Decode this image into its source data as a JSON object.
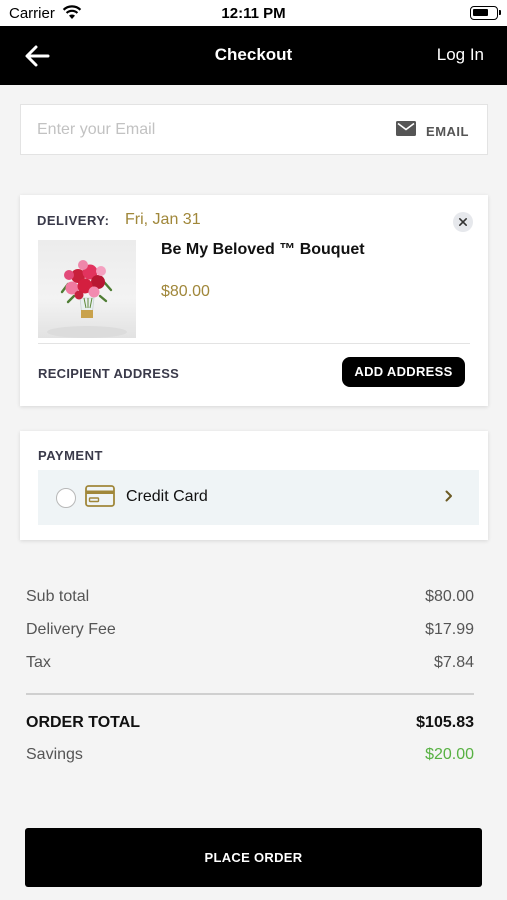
{
  "status_bar": {
    "carrier": "Carrier",
    "time": "12:11 PM"
  },
  "nav": {
    "title": "Checkout",
    "login_label": "Log In"
  },
  "email": {
    "placeholder": "Enter your Email",
    "button_label": "EMAIL"
  },
  "delivery": {
    "label": "DELIVERY:",
    "date": "Fri, Jan 31",
    "product_name": "Be My Beloved ™ Bouquet",
    "product_price": "$80.00",
    "recipient_label": "RECIPIENT ADDRESS",
    "add_address_label": "ADD ADDRESS"
  },
  "payment": {
    "label": "PAYMENT",
    "method_label": "Credit Card"
  },
  "summary": {
    "subtotal_label": "Sub total",
    "subtotal_value": "$80.00",
    "delivery_fee_label": "Delivery Fee",
    "delivery_fee_value": "$17.99",
    "tax_label": "Tax",
    "tax_value": "$7.84",
    "total_label": "ORDER TOTAL",
    "total_value": "$105.83",
    "savings_label": "Savings",
    "savings_value": "$20.00"
  },
  "place_order_label": "PLACE ORDER",
  "colors": {
    "gold": "#a0873a",
    "savings_green": "#57b142",
    "nav_bg": "#000000"
  }
}
